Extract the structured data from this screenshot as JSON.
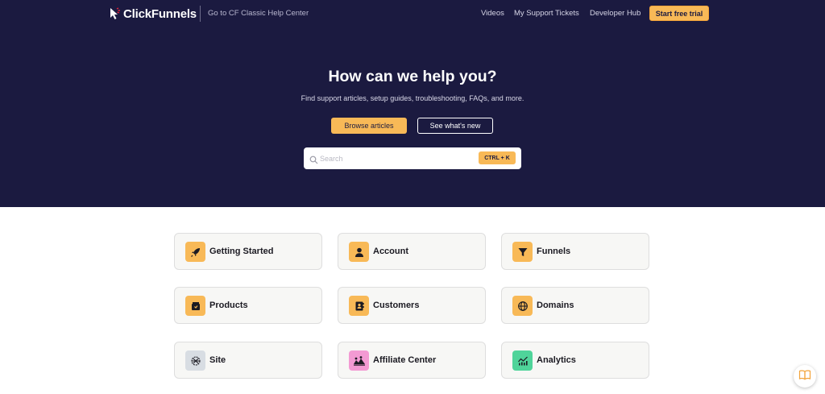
{
  "header": {
    "logo_text": "ClickFunnels",
    "classic_link": "Go to CF Classic Help Center",
    "nav": [
      "Videos",
      "My Support Tickets",
      "Developer Hub"
    ],
    "cta": "Start free trial"
  },
  "hero": {
    "title": "How can we help you?",
    "subtitle": "Find support articles, setup guides, troubleshooting, FAQs, and more.",
    "primary_button": "Browse articles",
    "secondary_button": "See what's new"
  },
  "search": {
    "placeholder": "Search",
    "shortcut": "CTRL + K"
  },
  "categories": [
    {
      "label": "Getting Started",
      "icon": "rocket-icon",
      "bg": "#f8b957"
    },
    {
      "label": "Account",
      "icon": "user-icon",
      "bg": "#f8b957"
    },
    {
      "label": "Funnels",
      "icon": "funnel-icon",
      "bg": "#f8b957"
    },
    {
      "label": "Products",
      "icon": "product-box-icon",
      "bg": "#f8b957"
    },
    {
      "label": "Customers",
      "icon": "contact-book-icon",
      "bg": "#f8b957"
    },
    {
      "label": "Domains",
      "icon": "globe-icon",
      "bg": "#f8b957"
    },
    {
      "label": "Site",
      "icon": "site-globe-icon",
      "bg": "#d8dde3"
    },
    {
      "label": "Affiliate Center",
      "icon": "affiliate-group-icon",
      "bg": "#f39ad3"
    },
    {
      "label": "Analytics",
      "icon": "analytics-chart-icon",
      "bg": "#4fd49a"
    }
  ],
  "colors": {
    "hero_bg": "#1b1a40",
    "accent": "#f8b957",
    "card_bg": "#f7f7f5"
  }
}
